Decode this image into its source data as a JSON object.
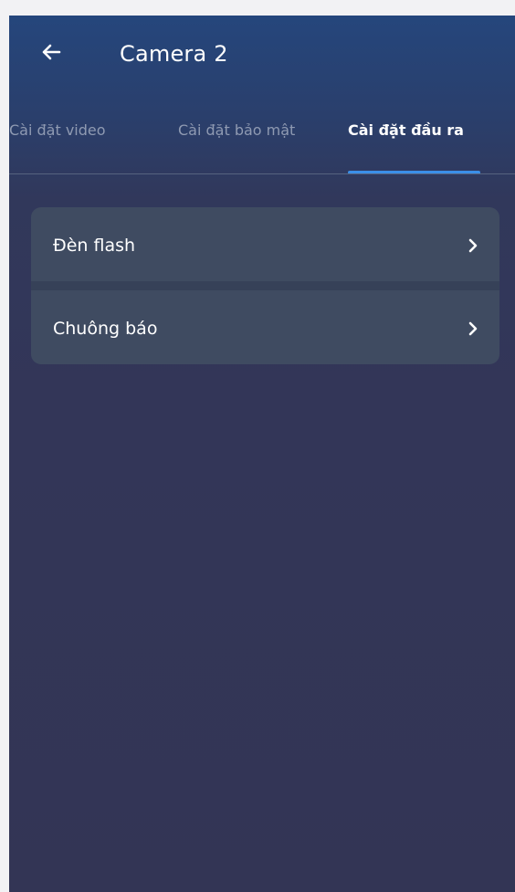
{
  "header": {
    "title": "Camera 2",
    "back_icon": "arrow-left-icon"
  },
  "tabs": [
    {
      "label": "Cài đặt video",
      "active": false
    },
    {
      "label": "Cài đặt bảo mật",
      "active": false
    },
    {
      "label": "Cài đặt đầu ra",
      "active": true
    }
  ],
  "menu": {
    "items": [
      {
        "label": "Đèn flash",
        "icon": "chevron-right-icon"
      },
      {
        "label": "Chuông báo",
        "icon": "chevron-right-icon"
      }
    ]
  },
  "colors": {
    "active_tab_indicator": "#3b8fe8",
    "card_background": "#3f4b61",
    "text_primary": "#ffffff",
    "text_muted": "#8f9ab2"
  }
}
